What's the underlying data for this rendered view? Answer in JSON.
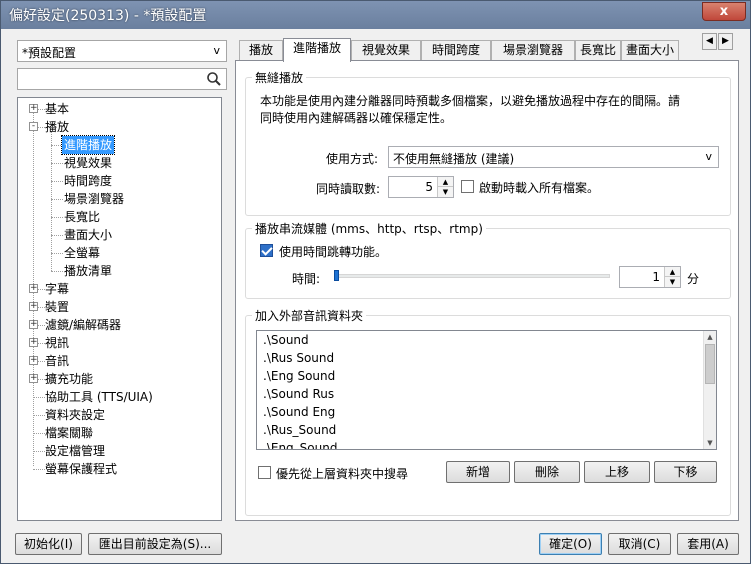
{
  "window": {
    "title": "偏好設定(250313) - *預設配置",
    "close_glyph": "x"
  },
  "sidebar": {
    "preset_value": "*預設配置",
    "search_placeholder": "",
    "tree": [
      {
        "label": "基本",
        "level": 0,
        "toggle": "+"
      },
      {
        "label": "播放",
        "level": 0,
        "toggle": "-"
      },
      {
        "label": "進階播放",
        "level": 1,
        "selected": true
      },
      {
        "label": "視覺效果",
        "level": 1
      },
      {
        "label": "時間跨度",
        "level": 1
      },
      {
        "label": "場景瀏覽器",
        "level": 1
      },
      {
        "label": "長寬比",
        "level": 1
      },
      {
        "label": "畫面大小",
        "level": 1
      },
      {
        "label": "全螢幕",
        "level": 1
      },
      {
        "label": "播放清單",
        "level": 1
      },
      {
        "label": "字幕",
        "level": 0,
        "toggle": "+"
      },
      {
        "label": "裝置",
        "level": 0,
        "toggle": "+"
      },
      {
        "label": "濾鏡/編解碼器",
        "level": 0,
        "toggle": "+"
      },
      {
        "label": "視訊",
        "level": 0,
        "toggle": "+"
      },
      {
        "label": "音訊",
        "level": 0,
        "toggle": "+"
      },
      {
        "label": "擴充功能",
        "level": 0,
        "toggle": "+"
      },
      {
        "label": "協助工具 (TTS/UIA)",
        "level": 0
      },
      {
        "label": "資料夾設定",
        "level": 0
      },
      {
        "label": "檔案關聯",
        "level": 0
      },
      {
        "label": "設定檔管理",
        "level": 0
      },
      {
        "label": "螢幕保護程式",
        "level": 0
      }
    ]
  },
  "tabs": [
    "播放",
    "進階播放",
    "視覺效果",
    "時間跨度",
    "場景瀏覽器",
    "長寬比",
    "畫面大小"
  ],
  "tab_scroll": {
    "left": "◀",
    "right": "▶"
  },
  "seamless": {
    "title": "無縫播放",
    "description_1": "本功能是使用內建分離器同時預載多個檔案，以避免播放過程中存在的間隔。請",
    "description_2": "同時使用內建解碼器以確保穩定性。",
    "usage_label": "使用方式:",
    "usage_value": "不使用無縫播放 (建議)",
    "simultaneous_label": "同時讀取數:",
    "simultaneous_value": "5",
    "load_all_label": "啟動時載入所有檔案。"
  },
  "streaming": {
    "title": "播放串流媒體 (mms、http、rtsp、rtmp)",
    "time_jump_label": "使用時間跳轉功能。",
    "time_label": "時間:",
    "time_value": "1",
    "unit": "分",
    "slider_level": 0
  },
  "audio_folder": {
    "title": "加入外部音訊資料夾",
    "items": [
      ".\\Sound",
      ".\\Rus Sound",
      ".\\Eng Sound",
      ".\\Sound Rus",
      ".\\Sound Eng",
      ".\\Rus_Sound",
      ".\\Eng_Sound"
    ],
    "prefer_parent_label": "優先從上層資料夾中搜尋",
    "add": "新增",
    "delete": "刪除",
    "move_up": "上移",
    "move_down": "下移"
  },
  "footer": {
    "reset": "初始化(I)",
    "export": "匯出目前設定為(S)...",
    "ok": "確定(O)",
    "cancel": "取消(C)",
    "apply": "套用(A)"
  },
  "colors": {
    "accent": "#3399ff",
    "titlebar": "#7289a8",
    "close": "#c0473a"
  },
  "icons": {
    "search": "search-icon",
    "dropdown": "chevron-down-icon"
  }
}
